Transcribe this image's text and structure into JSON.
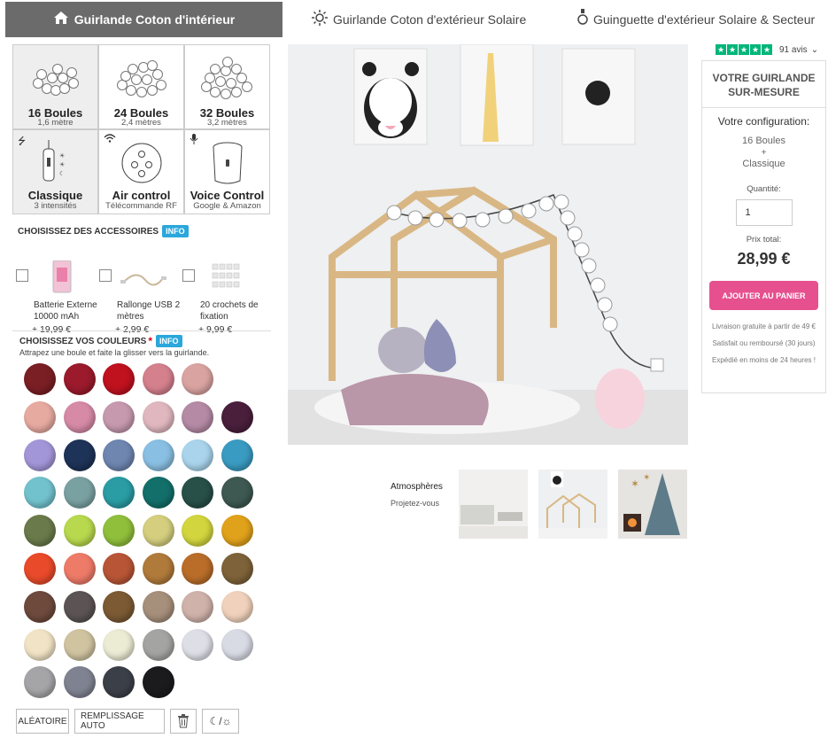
{
  "tabs": [
    {
      "label": "Guirlande Coton d'intérieur",
      "icon": "home-icon"
    },
    {
      "label": "Guirlande Coton d'extérieur Solaire",
      "icon": "sun-icon"
    },
    {
      "label": "Guinguette d'extérieur Solaire & Secteur",
      "icon": "bulb-icon"
    }
  ],
  "sizes": [
    {
      "title": "16 Boules",
      "sub": "1,6 mètre"
    },
    {
      "title": "24 Boules",
      "sub": "2,4 mètres"
    },
    {
      "title": "32 Boules",
      "sub": "3,2 mètres"
    }
  ],
  "controls": [
    {
      "title": "Classique",
      "sub": "3 intensités",
      "icon": "usb-icon"
    },
    {
      "title": "Air control",
      "sub": "Télécommande RF",
      "icon": "wifi-icon"
    },
    {
      "title": "Voice Control",
      "sub": "Google & Amazon",
      "icon": "microphone-icon"
    }
  ],
  "accessories": {
    "title": "CHOISISSEZ DES ACCESSOIRES",
    "info": "INFO",
    "items": [
      {
        "name": "Batterie Externe 10000 mAh",
        "price": "+ 19,99 €"
      },
      {
        "name": "Rallonge USB 2 mètres",
        "price": "+ 2,99 €"
      },
      {
        "name": "20 crochets de fixation",
        "price": "+ 9,99 €"
      }
    ]
  },
  "colors": {
    "title": "CHOISISSEZ VOS COULEURS",
    "required": "*",
    "info": "INFO",
    "subtitle": "Attrapez une boule et faite la glisser vers la guirlande.",
    "swatches": [
      "#7a1f24",
      "#9b1a2c",
      "#c0111f",
      "#d4808d",
      "#d9a3a1",
      "#e6aaa1",
      "#d68aa6",
      "#c699ae",
      "#e0b7bf",
      "#b58aa5",
      "#4a1f3c",
      "#a396d8",
      "#1e3358",
      "#6f86b0",
      "#89bfe2",
      "#a9d4ec",
      "#3a9bc2",
      "#72c2cd",
      "#7aa1a2",
      "#2a9ca4",
      "#136f6a",
      "#284f48",
      "#3e5852",
      "#6a7a4b",
      "#b8d84e",
      "#8fbf3b",
      "#d4ce7e",
      "#d2d53e",
      "#e1a21b",
      "#e84a2a",
      "#ee7a68",
      "#b85536",
      "#b07a3a",
      "#b96d29",
      "#7e6239",
      "#6e4a3d",
      "#5b5354",
      "#7b5a34",
      "#a68f7b",
      "#cfb2aa",
      "#f0d2bc",
      "#f1e3c5",
      "#cfc3a0",
      "#ecebd4",
      "#a4a4a2",
      "#dedfe6",
      "#d8dae4",
      "#a5a5a8",
      "#7f8391",
      "#3b3f48",
      "#1b1b1e"
    ]
  },
  "tools": {
    "random": "ALÉATOIRE",
    "autofill": "REMPLISSAGE AUTO",
    "trash": "🗑",
    "daynight": "☾/☼"
  },
  "atmospheres": {
    "title": "Atmosphères",
    "sub": "Projetez-vous"
  },
  "rating": {
    "stars": "★★★★★",
    "count": "91 avis",
    "chevron": "⌄"
  },
  "panel": {
    "title": "VOTRE GUIRLANDE",
    "title2": "SUR-MESURE",
    "config_label": "Votre configuration:",
    "config_line1": "16 Boules",
    "config_plus": "+",
    "config_line2": "Classique",
    "qty_label": "Quantité:",
    "qty_value": "1",
    "price_label": "Prix total:",
    "price": "28,99 €",
    "cart_button": "AJOUTER AU PANIER",
    "note1": "Livraison gratuite à partir de 49 €",
    "note2": "Satisfait ou remboursé (30 jours)",
    "note3": "Expédié en moins de 24 heures !"
  }
}
